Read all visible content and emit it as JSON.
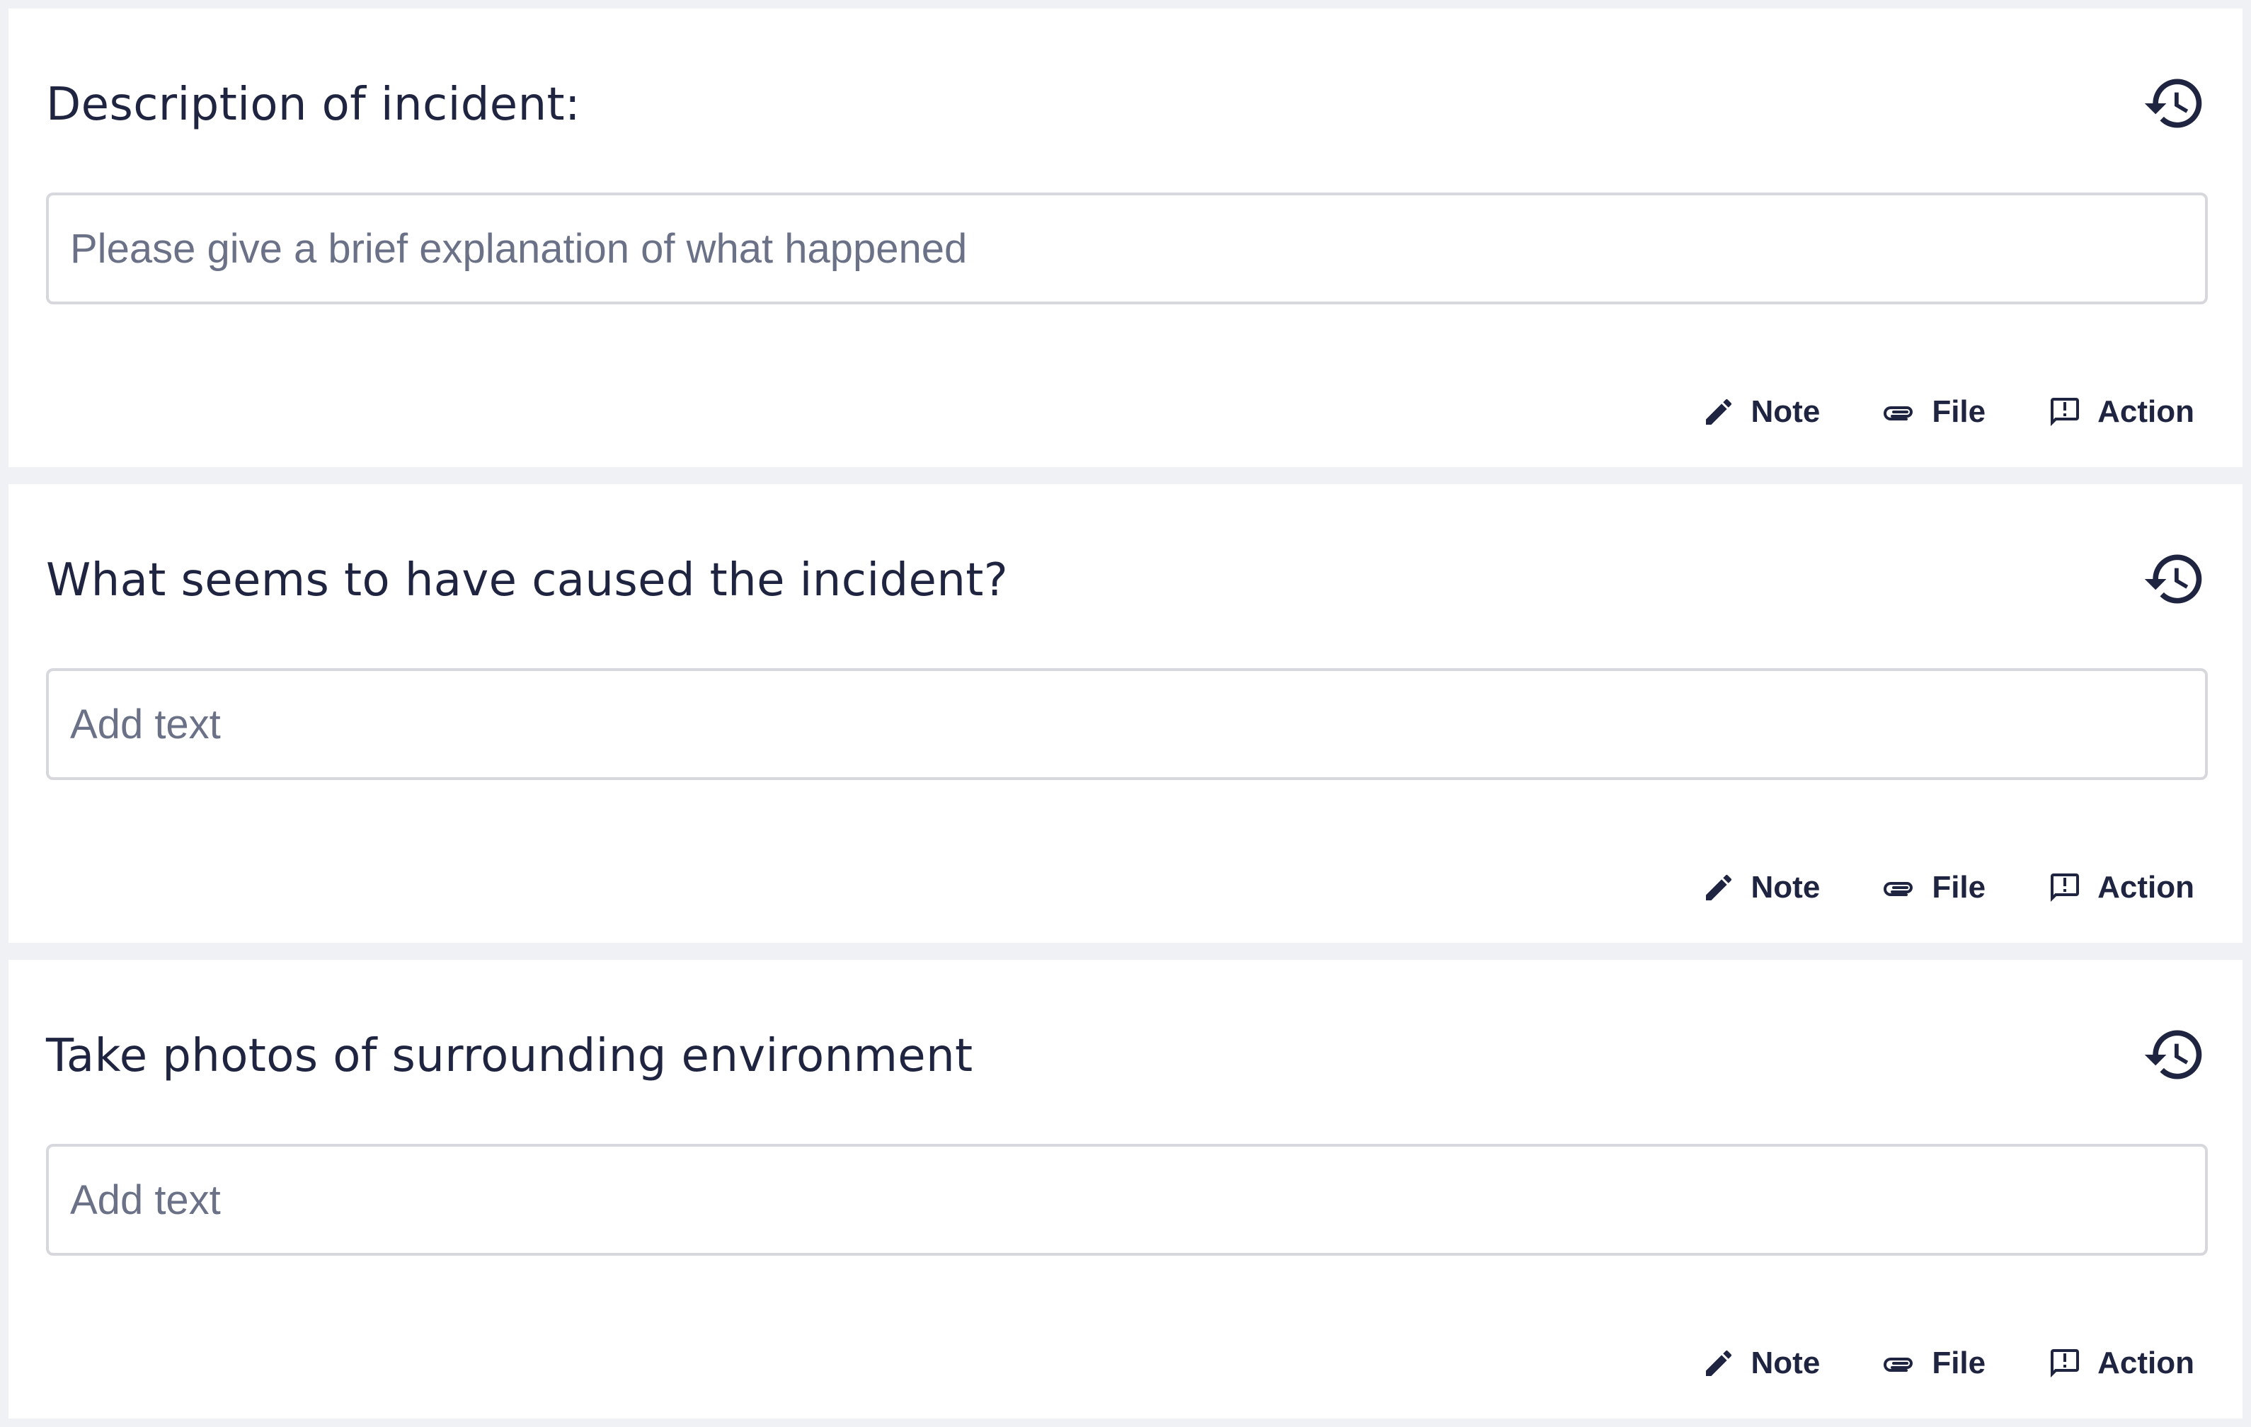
{
  "cards": [
    {
      "title": "Description of incident:",
      "input_placeholder": "Please give a brief explanation of what happened",
      "input_value": "",
      "actions": {
        "note": "Note",
        "file": "File",
        "action": "Action"
      }
    },
    {
      "title": "What seems to have caused the incident?",
      "input_placeholder": "Add text",
      "input_value": "",
      "actions": {
        "note": "Note",
        "file": "File",
        "action": "Action"
      }
    },
    {
      "title": "Take photos of surrounding environment",
      "input_placeholder": "Add text",
      "input_value": "",
      "actions": {
        "note": "Note",
        "file": "File",
        "action": "Action"
      }
    }
  ],
  "icons": {
    "history": "history-icon",
    "note": "pencil-icon",
    "file": "paperclip-icon",
    "action": "report-icon"
  },
  "colors": {
    "background": "#eff1f5",
    "card": "#ffffff",
    "text": "#1f2540",
    "placeholder": "#6b7287",
    "border": "#d6d8dd"
  }
}
